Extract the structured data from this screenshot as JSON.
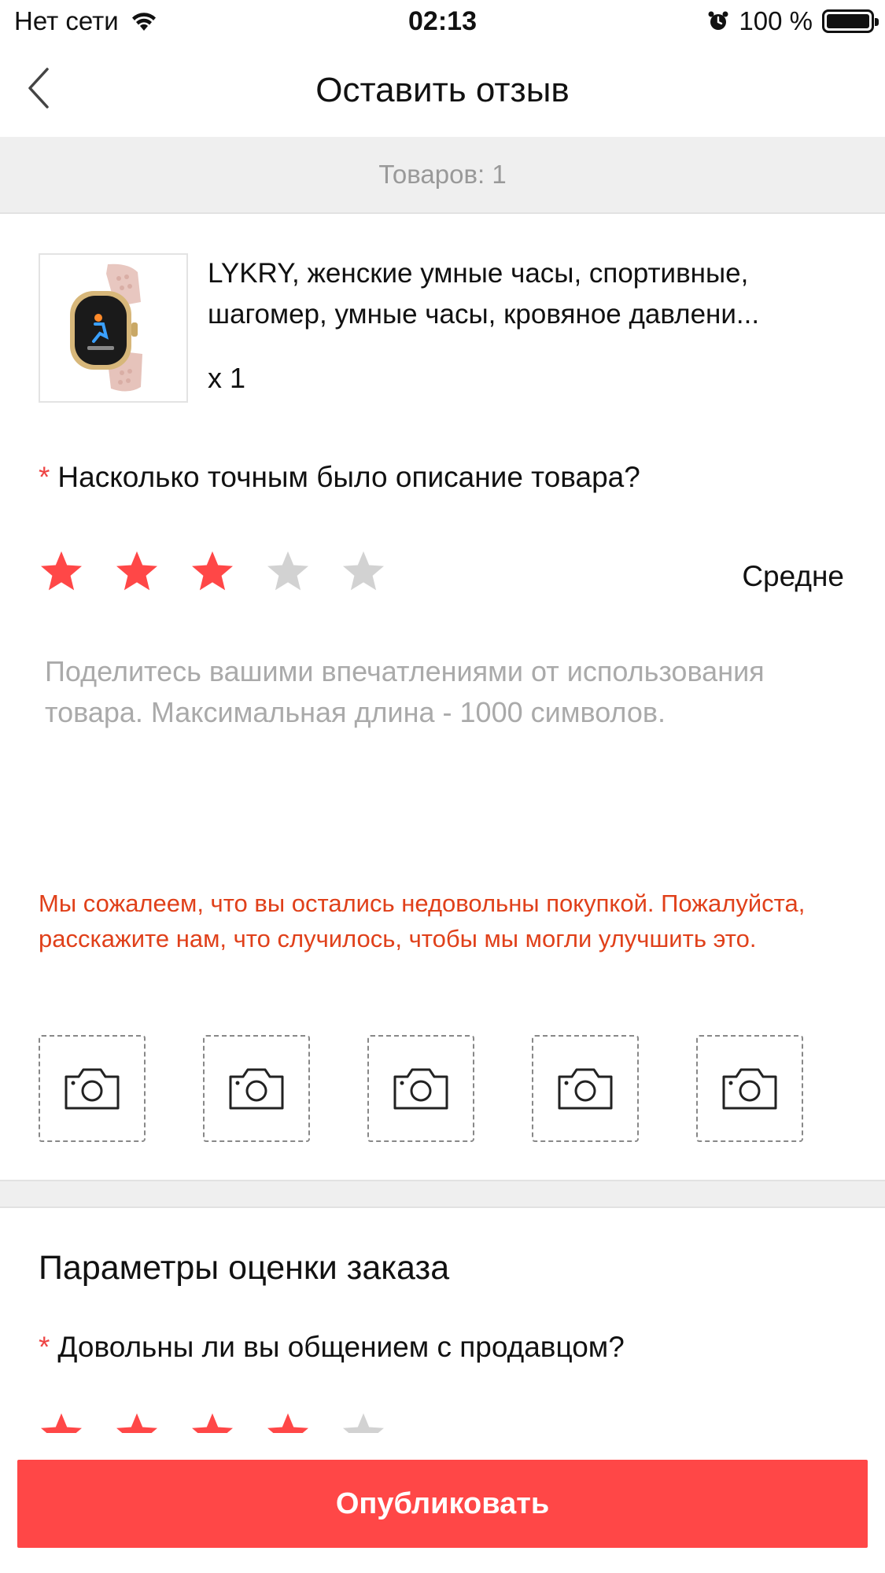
{
  "status_bar": {
    "carrier": "Нет сети",
    "time": "02:13",
    "battery": "100 %",
    "icons": [
      "wifi-icon",
      "alarm-icon",
      "battery-icon"
    ]
  },
  "nav": {
    "title": "Оставить отзыв",
    "back_icon": "chevron-left-icon"
  },
  "items_count": "Товаров: 1",
  "product": {
    "title_line1": "LYKRY, женские умные часы, спортивные,",
    "title_line2": "шагомер, умные часы, кровяное давлени...",
    "quantity": "x 1",
    "thumbnail_icon": "smartwatch-image"
  },
  "description_question": {
    "required_mark": "*",
    "text": "Насколько точным было описание товара?",
    "rating": 3,
    "max_rating": 5,
    "rating_label": "Средне"
  },
  "review": {
    "placeholder": "Поделитесь вашими впечатлениями от использования товара. Максимальная длина - 1000 символов.",
    "value": ""
  },
  "warning": "Мы сожалеем, что вы остались недовольны покупкой. Пожалуйста, расскажите нам, что случилось, чтобы мы могли улучшить это.",
  "photo_slots": 5,
  "order_params": {
    "title": "Параметры оценки заказа",
    "seller_question": {
      "required_mark": "*",
      "text": "Довольны ли вы общением с продавцом?",
      "rating": 4,
      "max_rating": 5
    }
  },
  "publish_button": "Опубликовать",
  "colors": {
    "accent": "#ff4747",
    "star_active": "#ff4747",
    "star_inactive": "#d2d2d2",
    "warning": "#e0401a"
  }
}
